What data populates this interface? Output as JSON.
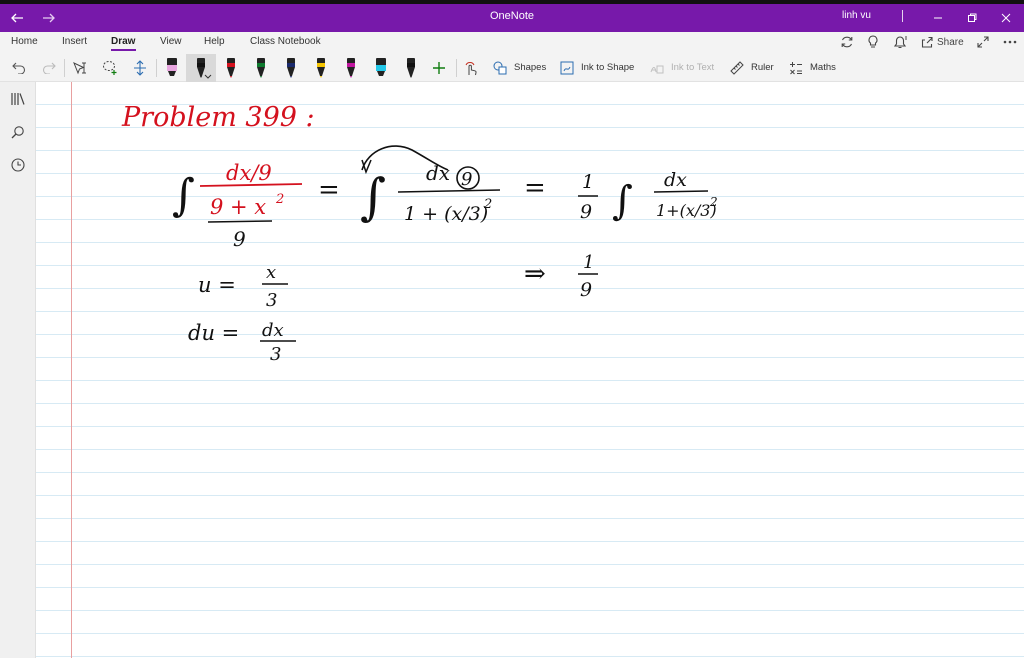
{
  "window": {
    "title": "OneNote",
    "user": "linh vu"
  },
  "menu": {
    "tabs": [
      {
        "label": "Home"
      },
      {
        "label": "Insert"
      },
      {
        "label": "Draw"
      },
      {
        "label": "View"
      },
      {
        "label": "Help"
      },
      {
        "label": "Class Notebook"
      }
    ],
    "active_tab": "Draw",
    "share_label": "Share"
  },
  "toolbar": {
    "shapes_label": "Shapes",
    "ink_to_shape_label": "Ink to Shape",
    "ink_to_text_label": "Ink to Text",
    "ruler_label": "Ruler",
    "maths_label": "Maths",
    "pens": [
      {
        "name": "highlighter-pink",
        "color": "#e8a6e0"
      },
      {
        "name": "pen-black-selected",
        "color": "#111111"
      },
      {
        "name": "pen-red",
        "color": "#d4111e"
      },
      {
        "name": "pen-green",
        "color": "#0e7a2e"
      },
      {
        "name": "pen-navy",
        "color": "#1a2a6c"
      },
      {
        "name": "pen-yellow",
        "color": "#f4c400"
      },
      {
        "name": "pen-magenta",
        "color": "#c0169f"
      },
      {
        "name": "highlighter-cyan",
        "color": "#22c7e8"
      },
      {
        "name": "pen-black",
        "color": "#111111"
      }
    ]
  },
  "colors": {
    "brand": "#7719aa",
    "ink_red": "#d4111e",
    "ink_black": "#111111"
  },
  "note": {
    "heading": "Problem 399 :",
    "lines": [
      "∫ (dx/9) / ((9 + x²)/9) = ∫ (dx/9) / (1 + (x/3)²) = (1/9) ∫ dx / (1+(x/3)²)",
      "u = x/3",
      "du = dx/3",
      "⇒ 1/9"
    ],
    "eq1": {
      "lhs_num": "dx/9",
      "lhs_den_top": "9 + x",
      "lhs_den_exp": "2",
      "lhs_den_bottom": "9",
      "eq": "=",
      "mid_num": "dx",
      "mid_circled": "9",
      "mid_den": "1 + (x/3)",
      "mid_den_exp": "2",
      "eq2": "=",
      "coef_num": "1",
      "coef_den": "9",
      "rhs_num": "dx",
      "rhs_den": "1+(x/3)",
      "rhs_den_exp": "2"
    },
    "sub": {
      "u_lhs": "u =",
      "u_num": "x",
      "u_den": "3",
      "du_lhs": "du =",
      "du_num": "dx",
      "du_den": "3",
      "implies": "⇒",
      "res_num": "1",
      "res_den": "9"
    }
  }
}
